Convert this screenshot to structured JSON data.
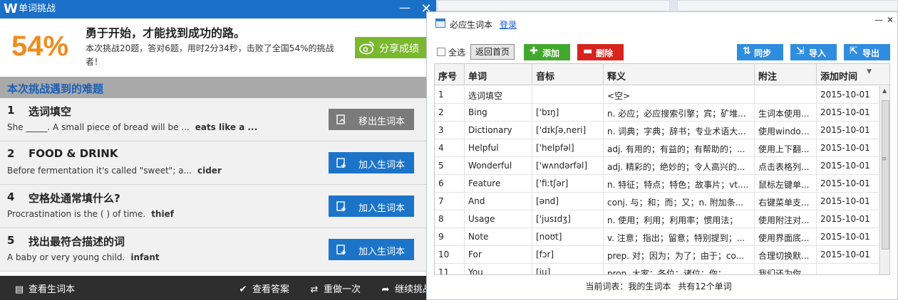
{
  "left_window": {
    "title": "单词挑战",
    "logo": "W",
    "minimize_glyph": "—",
    "close_glyph": "✕",
    "percent": "54%",
    "motto": "勇于开始，才能找到成功的路。",
    "summary": "本次挑战20题，答对6题，用时2分34秒，击败了全国54%的挑战者！",
    "share_label": "分享成绩",
    "section_title": "本次挑战遇到的难题",
    "items": [
      {
        "num": "1",
        "title": "选词填空",
        "desc": "She _____. A small piece of bread will be ...",
        "answer": "eats like a ...",
        "button": "移出生词本",
        "style": "gray",
        "icon": "remove-from-book-icon"
      },
      {
        "num": "2",
        "title": "FOOD & DRINK",
        "desc": "Before fermentation it's called \"sweet\"; a...",
        "answer": "cider",
        "button": "加入生词本",
        "style": "blue",
        "icon": "add-to-book-icon"
      },
      {
        "num": "4",
        "title": "空格处通常填什么?",
        "desc": "Procrastination is the ( ) of time.",
        "answer": "thief",
        "button": "加入生词本",
        "style": "blue",
        "icon": "add-to-book-icon"
      },
      {
        "num": "5",
        "title": "找出最符合描述的词",
        "desc": "A baby or very young child.",
        "answer": "infant",
        "button": "加入生词本",
        "style": "blue",
        "icon": "add-to-book-icon"
      }
    ],
    "bottom": {
      "view_book": "查看生词本",
      "view_answers": "查看答案",
      "redo": "重做一次",
      "continue": "继续挑战"
    }
  },
  "right_window": {
    "title": "必应生词本",
    "login": "登录",
    "minimize_glyph": "—",
    "close_glyph": "✕",
    "select_all": "全选",
    "home": "返回首页",
    "add": "添加",
    "delete": "删除",
    "sync": "同步",
    "import": "导入",
    "export": "导出",
    "columns": [
      "序号",
      "单词",
      "音标",
      "释义",
      "附注",
      "添加时间"
    ],
    "rows": [
      [
        "1",
        "选词填空",
        "",
        "<空>",
        "",
        "2015-10-01"
      ],
      [
        "2",
        "Bing",
        "['bɪŋ]",
        "n. 必应；必应搜索引擎；宾；矿堆...",
        "生词本使用...",
        "2015-10-01"
      ],
      [
        "3",
        "Dictionary",
        "['dɪkʃə,neri]",
        "n. 词典；字典；辞书；专业术语大...",
        "使用window...",
        "2015-10-01"
      ],
      [
        "4",
        "Helpful",
        "['helpfəl]",
        "adj. 有用的；有益的；有帮助的；...",
        "使用上下翻...",
        "2015-10-01"
      ],
      [
        "5",
        "Wonderful",
        "['wʌndərfəl]",
        "adj. 精彩的；绝妙的；令人高兴的...",
        "点击表格列...",
        "2015-10-01"
      ],
      [
        "6",
        "Feature",
        "['fiːtʃər]",
        "n. 特征；特点；特色；故事片；vt....",
        "鼠标左键单...",
        "2015-10-01"
      ],
      [
        "7",
        "And",
        "[ənd]",
        "conj. 与；和；而；又；n. 附加条...",
        "右键菜单支...",
        "2015-10-01"
      ],
      [
        "8",
        "Usage",
        "['jusɪdʒ]",
        "n. 使用；利用；利用率；惯用法；",
        "使用附注对...",
        "2015-10-01"
      ],
      [
        "9",
        "Note",
        "[noʊt]",
        "v. 注意；指出；留意；特别提到；...",
        "使用界面底...",
        "2015-10-01"
      ],
      [
        "10",
        "For",
        "[fɔr]",
        "prep. 对；因为；为了；由于；co...",
        "合理切换默...",
        "2015-10-01"
      ],
      [
        "11",
        "You",
        "[ju]",
        "pron. 大家；各位；诸位；你；",
        "我们还为你...",
        ""
      ]
    ],
    "status_current": "当前词表：我的生词本",
    "status_count": "共有12个单词"
  }
}
